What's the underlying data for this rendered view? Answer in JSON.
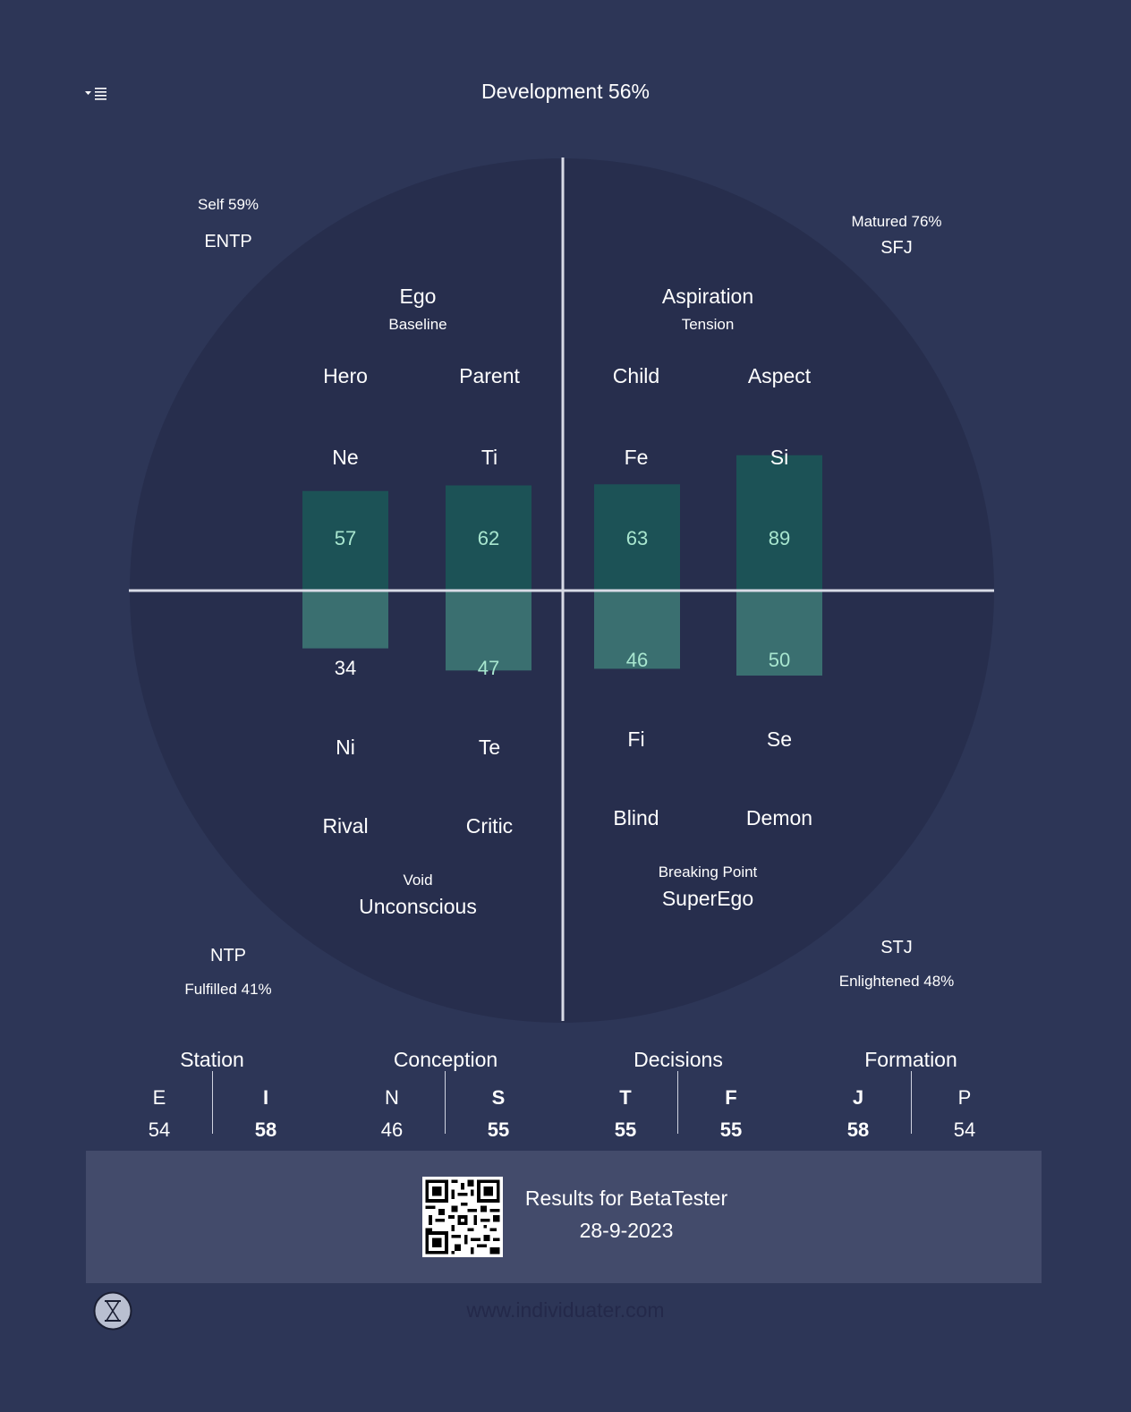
{
  "header": {
    "title": "Development 56%",
    "menu_icon": "dropdown-list-icon"
  },
  "quadrants": {
    "top_left": {
      "score": "Self 59%",
      "type": "ENTP"
    },
    "top_right": {
      "score": "Matured 76%",
      "type": "SFJ"
    },
    "bottom_left": {
      "type": "NTP",
      "score": "Fulfilled 41%"
    },
    "bottom_right": {
      "type": "STJ",
      "score": "Enlightened 48%"
    }
  },
  "groups": {
    "ego": {
      "title": "Ego",
      "subtitle": "Baseline"
    },
    "aspiration": {
      "title": "Aspiration",
      "subtitle": "Tension"
    },
    "unconscious": {
      "title": "Unconscious",
      "subtitle": "Void"
    },
    "superego": {
      "title": "SuperEgo",
      "subtitle": "Breaking Point"
    }
  },
  "roles_top": [
    "Hero",
    "Parent",
    "Child",
    "Aspect"
  ],
  "functions_top": [
    "Ne",
    "Ti",
    "Fe",
    "Si"
  ],
  "functions_bottom": [
    "Ni",
    "Te",
    "Fi",
    "Se"
  ],
  "roles_bottom": [
    "Rival",
    "Critic",
    "Blind",
    "Demon"
  ],
  "chart_data": {
    "type": "bar",
    "categories": [
      "Ne / Ni",
      "Ti / Te",
      "Fe / Fi",
      "Si / Se"
    ],
    "series": [
      {
        "values": [
          57,
          62,
          63,
          89
        ]
      },
      {
        "values": [
          34,
          47,
          46,
          50
        ]
      }
    ],
    "top_labels": [
      "57",
      "62",
      "63",
      "89"
    ],
    "bottom_labels": [
      "34",
      "47",
      "46",
      "50"
    ],
    "colors": {
      "top": "#1c5256",
      "bottom": "#3a6f70",
      "label_top": "#a8e6cf",
      "label_bottom_inside": "#a8e6cf",
      "label_bottom_outside": "#ffffff",
      "circle": "#272e4d",
      "axis": "#d8dbe6"
    }
  },
  "dichotomies": [
    {
      "title": "Station",
      "left": {
        "letter": "E",
        "value": "54",
        "bold": false
      },
      "right": {
        "letter": "I",
        "value": "58",
        "bold": true
      }
    },
    {
      "title": "Conception",
      "left": {
        "letter": "N",
        "value": "46",
        "bold": false
      },
      "right": {
        "letter": "S",
        "value": "55",
        "bold": true
      }
    },
    {
      "title": "Decisions",
      "left": {
        "letter": "T",
        "value": "55",
        "bold": true
      },
      "right": {
        "letter": "F",
        "value": "55",
        "bold": true
      }
    },
    {
      "title": "Formation",
      "left": {
        "letter": "J",
        "value": "58",
        "bold": true
      },
      "right": {
        "letter": "P",
        "value": "54",
        "bold": false
      }
    }
  ],
  "footer": {
    "results_title": "Results for BetaTester",
    "date": "28-9-2023",
    "qr_icon": "qr-code-icon",
    "website": "www.individuater.com",
    "logo_icon": "hourglass-logo-icon"
  }
}
